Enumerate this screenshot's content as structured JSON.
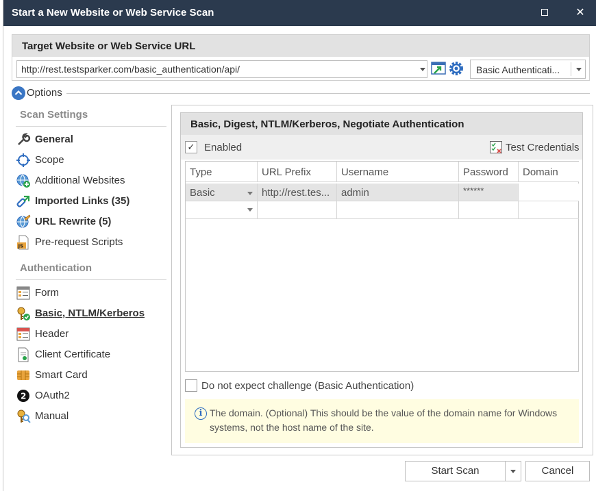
{
  "window": {
    "title": "Start a New Website or Web Service Scan",
    "maximize_label": "",
    "close_label": "✕"
  },
  "target": {
    "header": "Target Website or Web Service URL",
    "url_value": "http://rest.testsparker.com/basic_authentication/api/",
    "auth_profile": "Basic Authenticati..."
  },
  "options": {
    "label": "Options"
  },
  "sidebar": {
    "scan_settings_title": "Scan Settings",
    "authentication_title": "Authentication",
    "scan_items": [
      {
        "label": "General",
        "icon": "wrench-icon",
        "bold": true
      },
      {
        "label": "Scope",
        "icon": "crosshair-icon",
        "bold": false
      },
      {
        "label": "Additional Websites",
        "icon": "globe-plus-icon",
        "bold": false
      },
      {
        "label": "Imported Links (35)",
        "icon": "import-links-icon",
        "bold": true
      },
      {
        "label": "URL Rewrite (5)",
        "icon": "globe-rewrite-icon",
        "bold": true
      },
      {
        "label": "Pre-request Scripts",
        "icon": "js-script-icon",
        "bold": false
      }
    ],
    "auth_items": [
      {
        "label": "Form",
        "icon": "form-icon"
      },
      {
        "label": "Basic, NTLM/Kerberos",
        "icon": "key-check-icon",
        "selected": true
      },
      {
        "label": "Header",
        "icon": "header-icon"
      },
      {
        "label": "Client Certificate",
        "icon": "certificate-icon"
      },
      {
        "label": "Smart Card",
        "icon": "smart-card-icon"
      },
      {
        "label": "OAuth2",
        "icon": "oauth2-icon"
      },
      {
        "label": "Manual",
        "icon": "manual-key-icon"
      }
    ]
  },
  "auth_panel": {
    "header": "Basic, Digest, NTLM/Kerberos, Negotiate Authentication",
    "enabled_label": "Enabled",
    "enabled_checked": true,
    "test_credentials_label": "Test Credentials",
    "columns": [
      "Type",
      "URL Prefix",
      "Username",
      "Password",
      "Domain"
    ],
    "rows": [
      {
        "type": "Basic",
        "url_prefix": "http://rest.tes...",
        "username": "admin",
        "password": "******",
        "domain": ""
      }
    ],
    "no_challenge_label": "Do not expect challenge (Basic Authentication)",
    "no_challenge_checked": false,
    "info_text": "The domain. (Optional) This should be the value of the domain name for Windows systems, not the host name of the site."
  },
  "footer": {
    "start_scan_label": "Start Scan",
    "cancel_label": "Cancel"
  },
  "colors": {
    "titlebar": "#2b3a4e",
    "accent_blue": "#3a76c4",
    "info_bg": "#fffde1",
    "header_gray": "#e2e2e2"
  }
}
